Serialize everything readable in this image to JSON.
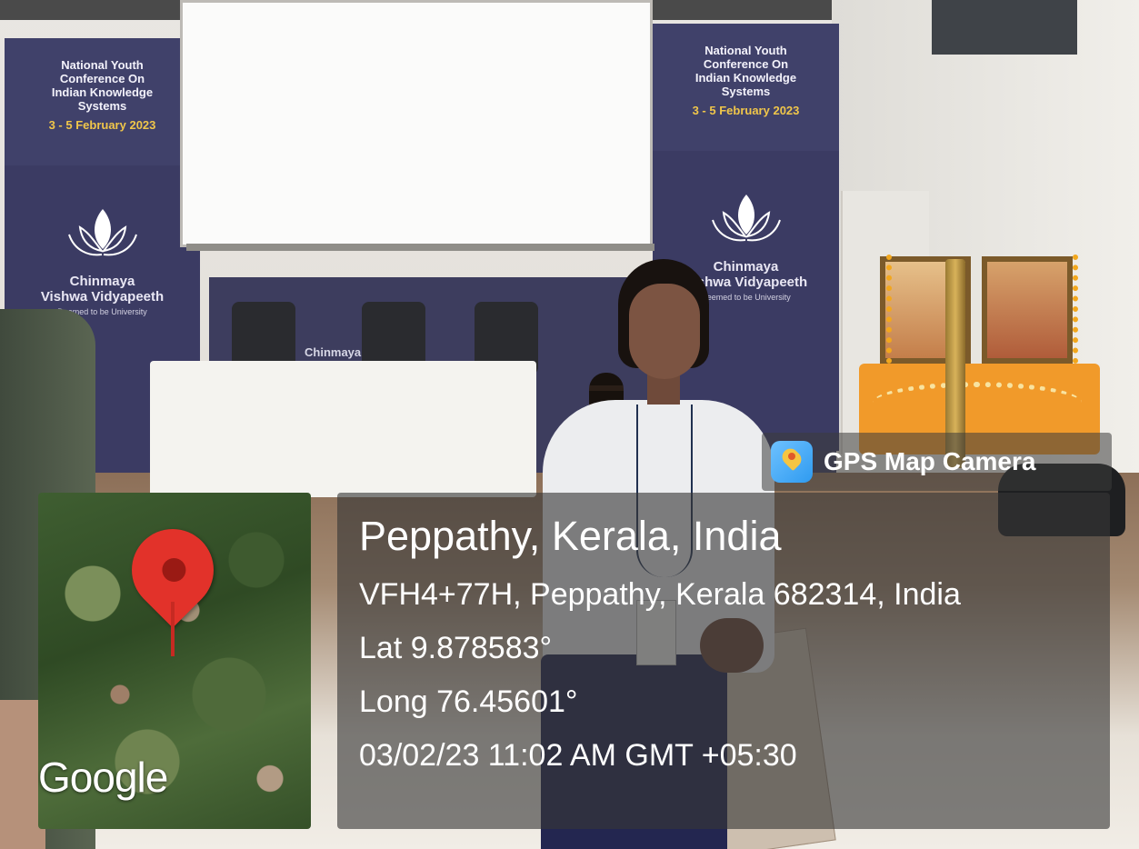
{
  "banner_left": {
    "conference": [
      "National Youth",
      "Conference On",
      "Indian Knowledge",
      "Systems"
    ],
    "dates": "3 - 5 February 2023",
    "university_line1": "Chinmaya",
    "university_line2": "Vishwa Vidyapeeth",
    "university_line3": "Deemed to be University"
  },
  "banner_right": {
    "conference": [
      "National Youth",
      "Conference On",
      "Indian Knowledge",
      "Systems"
    ],
    "dates": "3 - 5 February 2023",
    "university_line1": "Chinmaya",
    "university_line2": "Vishwa Vidyapeeth",
    "university_line3": "Deemed to be University"
  },
  "table_label": "Chinmaya",
  "overlay": {
    "brand_label": "GPS Map Camera",
    "brand_icon": "gps-map-camera-icon",
    "map_attribution": "Google",
    "map_marker_icon": "map-pin-icon",
    "location_title": "Peppathy, Kerala, India",
    "address": "VFH4+77H, Peppathy, Kerala 682314, India",
    "latitude": "Lat 9.878583°",
    "longitude": "Long 76.45601°",
    "timestamp": "03/02/23 11:02 AM GMT +05:30"
  },
  "colors": {
    "banner": "#3b3b63",
    "banner_dates": "#f0c64a",
    "pin": "#e2322a",
    "overlay_panel": "#373737"
  }
}
